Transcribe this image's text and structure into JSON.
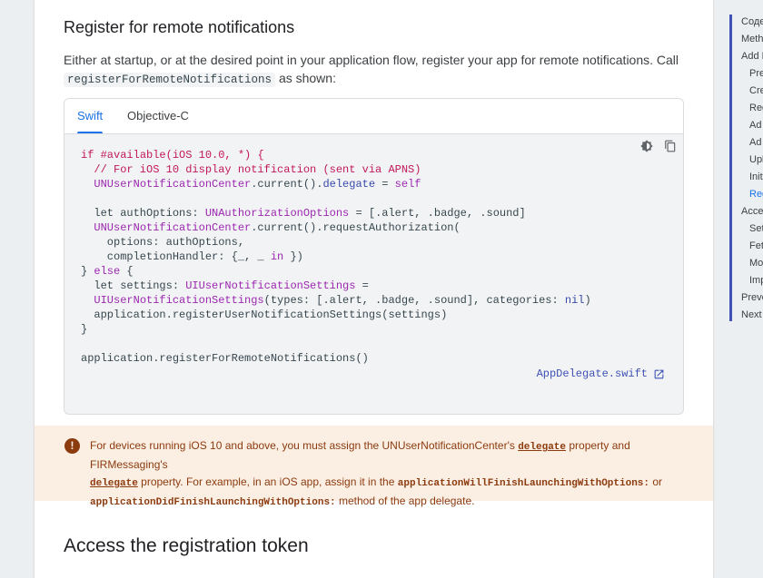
{
  "section": {
    "title": "Register for remote notifications",
    "intro_text": "Either at startup, or at the desired point in your application flow, register your app for remote notifications. Call",
    "intro_code": "registerForRemoteNotifications",
    "intro_suffix": "as shown:"
  },
  "code_tabs": [
    {
      "label": "Swift",
      "active": true
    },
    {
      "label": "Objective-C",
      "active": false
    }
  ],
  "code_tools": [
    "theme-toggle-icon",
    "copy-icon"
  ],
  "code_lines": [
    "if #available(iOS 10.0, *) {",
    "  // For iOS 10 display notification (sent via APNS)",
    "  UNUserNotificationCenter.current().delegate = self",
    "",
    "  let authOptions: UNAuthorizationOptions = [.alert, .badge, .sound]",
    "  UNUserNotificationCenter.current().requestAuthorization(",
    "    options: authOptions,",
    "    completionHandler: {_, _ in })",
    "} else {",
    "  let settings: UIUserNotificationSettings =",
    "  UIUserNotificationSettings(types: [.alert, .badge, .sound], categories: nil)",
    "  application.registerUserNotificationSettings(settings)",
    "}",
    "",
    "application.registerForRemoteNotifications()"
  ],
  "file_link": "AppDelegate.swift",
  "warning": {
    "t1": "For devices running iOS 10 and above, you must assign the UNUserNotificationCenter's",
    "c1": "delegate",
    "t2": "property and FIRMessaging's",
    "c2": "delegate",
    "t3": "property. For example, in an iOS app, assign it in the",
    "c3": "applicationWillFinishLaunchingWithOptions:",
    "t4": "or",
    "c4": "applicationDidFinishLaunchingWithOptions:",
    "t5": "method of the app delegate."
  },
  "next_section_title": "Access the registration token",
  "toc": [
    {
      "label": "Содер",
      "level": 0
    },
    {
      "label": "Meth",
      "level": 0
    },
    {
      "label": "Add F",
      "level": 0
    },
    {
      "label": "Pre",
      "level": 1
    },
    {
      "label": "Cre",
      "level": 1
    },
    {
      "label": "Reg",
      "level": 1
    },
    {
      "label": "Ad",
      "level": 1
    },
    {
      "label": "Ad",
      "level": 1
    },
    {
      "label": "Upl",
      "level": 1
    },
    {
      "label": "Init",
      "level": 1
    },
    {
      "label": "Reg",
      "level": 1,
      "active": true
    },
    {
      "label": "Acce",
      "level": 0
    },
    {
      "label": "Set",
      "level": 1
    },
    {
      "label": "Fet",
      "level": 1
    },
    {
      "label": "Mo",
      "level": 1
    },
    {
      "label": "Imp",
      "level": 1
    },
    {
      "label": "Preve",
      "level": 0
    },
    {
      "label": "Next",
      "level": 0
    }
  ]
}
